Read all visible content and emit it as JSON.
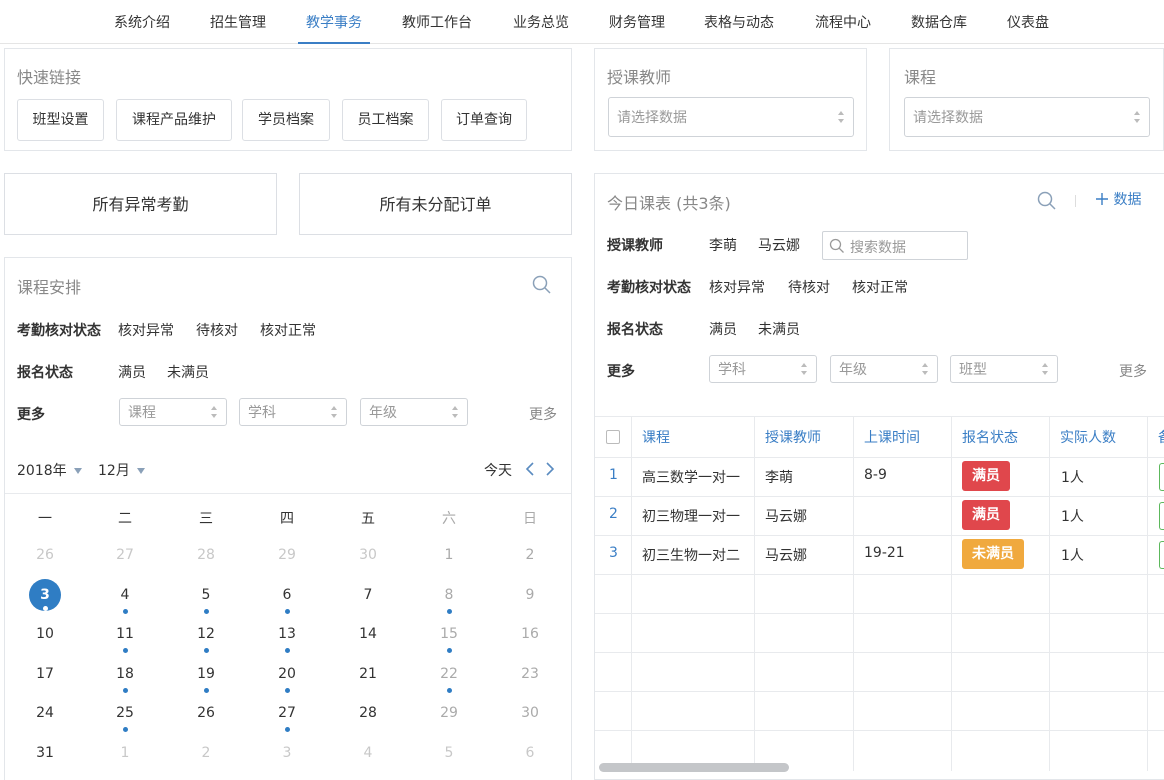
{
  "nav": {
    "items": [
      "系统介绍",
      "招生管理",
      "教学事务",
      "教师工作台",
      "业务总览",
      "财务管理",
      "表格与动态",
      "流程中心",
      "数据仓库",
      "仪表盘"
    ],
    "active_index": 2
  },
  "quick_links": {
    "title": "快速链接",
    "buttons": [
      "班型设置",
      "课程产品维护",
      "学员档案",
      "员工档案",
      "订单查询"
    ]
  },
  "teacher_filter": {
    "title": "授课教师",
    "placeholder": "请选择数据"
  },
  "course_filter": {
    "title": "课程",
    "placeholder": "请选择数据"
  },
  "shortcuts": {
    "abnormal": "所有异常考勤",
    "unassigned": "所有未分配订单"
  },
  "schedule": {
    "title": "课程安排",
    "attendance_label": "考勤核对状态",
    "attendance_options": [
      "核对异常",
      "待核对",
      "核对正常"
    ],
    "enroll_label": "报名状态",
    "enroll_options": [
      "满员",
      "未满员"
    ],
    "more_label": "更多",
    "more_selects": [
      "课程",
      "学科",
      "年级"
    ],
    "more_link": "更多",
    "year": "2018年",
    "month": "12月",
    "today_btn": "今天",
    "weekdays": [
      "一",
      "二",
      "三",
      "四",
      "五",
      "六",
      "日"
    ],
    "weeks": [
      [
        {
          "d": "26",
          "o": true
        },
        {
          "d": "27",
          "o": true
        },
        {
          "d": "28",
          "o": true
        },
        {
          "d": "29",
          "o": true
        },
        {
          "d": "30",
          "o": true
        },
        {
          "d": "1"
        },
        {
          "d": "2"
        }
      ],
      [
        {
          "d": "3",
          "today": true,
          "dot": true
        },
        {
          "d": "4",
          "dot": true
        },
        {
          "d": "5",
          "dot": true
        },
        {
          "d": "6",
          "dot": true
        },
        {
          "d": "7"
        },
        {
          "d": "8",
          "dot": true
        },
        {
          "d": "9"
        }
      ],
      [
        {
          "d": "10"
        },
        {
          "d": "11",
          "dot": true
        },
        {
          "d": "12",
          "dot": true
        },
        {
          "d": "13",
          "dot": true
        },
        {
          "d": "14"
        },
        {
          "d": "15",
          "dot": true
        },
        {
          "d": "16"
        }
      ],
      [
        {
          "d": "17"
        },
        {
          "d": "18",
          "dot": true
        },
        {
          "d": "19",
          "dot": true
        },
        {
          "d": "20",
          "dot": true
        },
        {
          "d": "21"
        },
        {
          "d": "22",
          "dot": true
        },
        {
          "d": "23"
        }
      ],
      [
        {
          "d": "24"
        },
        {
          "d": "25",
          "dot": true
        },
        {
          "d": "26"
        },
        {
          "d": "27",
          "dot": true
        },
        {
          "d": "28"
        },
        {
          "d": "29"
        },
        {
          "d": "30"
        }
      ],
      [
        {
          "d": "31"
        },
        {
          "d": "1",
          "o": true
        },
        {
          "d": "2",
          "o": true
        },
        {
          "d": "3",
          "o": true
        },
        {
          "d": "4",
          "o": true
        },
        {
          "d": "5",
          "o": true
        },
        {
          "d": "6",
          "o": true
        }
      ]
    ]
  },
  "today": {
    "title": "今日课表 (共3条)",
    "add_label": "数据",
    "teacher_label": "授课教师",
    "teacher_options": [
      "李萌",
      "马云娜"
    ],
    "search_placeholder": "搜索数据",
    "attendance_label": "考勤核对状态",
    "attendance_options": [
      "核对异常",
      "待核对",
      "核对正常"
    ],
    "enroll_label": "报名状态",
    "enroll_options": [
      "满员",
      "未满员"
    ],
    "more_label": "更多",
    "more_selects": [
      "学科",
      "年级",
      "班型"
    ],
    "more_link": "更多",
    "columns": [
      "课程",
      "授课教师",
      "上课时间",
      "报名状态",
      "实际人数"
    ],
    "rows": [
      {
        "no": "1",
        "course": "高三数学一对一",
        "teacher": "李萌",
        "time": "8-9",
        "status": "满员",
        "status_color": "#e0474c",
        "count": "1人"
      },
      {
        "no": "2",
        "course": "初三物理一对一",
        "teacher": "马云娜",
        "time": "",
        "status": "满员",
        "status_color": "#e0474c",
        "count": "1人"
      },
      {
        "no": "3",
        "course": "初三生物一对二",
        "teacher": "马云娜",
        "time": "19-21",
        "status": "未满员",
        "status_color": "#f0a93e",
        "count": "1人"
      }
    ]
  },
  "colors": {
    "accent": "#3a7ec5",
    "full": "#e0474c",
    "not_full": "#f0a93e"
  }
}
